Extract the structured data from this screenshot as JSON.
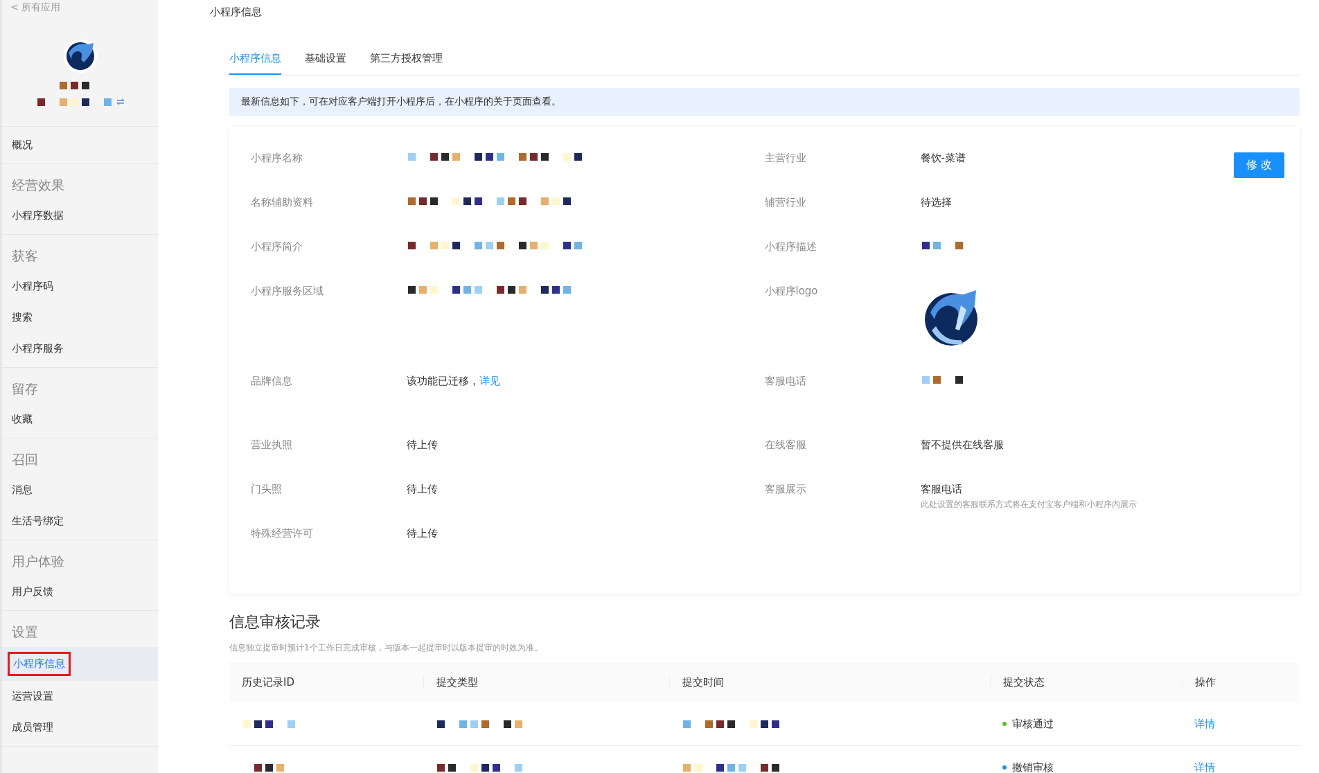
{
  "sidebar": {
    "back_link": "< 所有应用",
    "groups": [
      {
        "items": [
          {
            "label": "概况",
            "selected": false
          }
        ]
      },
      {
        "title": "经营效果",
        "items": [
          {
            "label": "小程序数据",
            "selected": false
          }
        ]
      },
      {
        "title": "获客",
        "items": [
          {
            "label": "小程序码",
            "selected": false
          },
          {
            "label": "搜索",
            "selected": false
          },
          {
            "label": "小程序服务",
            "selected": false
          }
        ]
      },
      {
        "title": "留存",
        "items": [
          {
            "label": "收藏",
            "selected": false
          }
        ]
      },
      {
        "title": "召回",
        "items": [
          {
            "label": "消息",
            "selected": false
          },
          {
            "label": "生活号绑定",
            "selected": false
          }
        ]
      },
      {
        "title": "用户体验",
        "items": [
          {
            "label": "用户反馈",
            "selected": false
          }
        ]
      },
      {
        "title": "设置",
        "items": [
          {
            "label": "小程序信息",
            "selected": true
          },
          {
            "label": "运营设置",
            "selected": false
          },
          {
            "label": "成员管理",
            "selected": false
          }
        ]
      }
    ]
  },
  "breadcrumb": "小程序信息",
  "tabs": [
    {
      "label": "小程序信息",
      "selected": true
    },
    {
      "label": "基础设置",
      "selected": false
    },
    {
      "label": "第三方授权管理",
      "selected": false
    }
  ],
  "notice": "最新信息如下，可在对应客户端打开小程序后，在小程序的关于页面查看。",
  "edit_button": "修 改",
  "info_rows": [
    {
      "left": {
        "label": "小程序名称",
        "kind": "redacted"
      },
      "right": {
        "label": "主营行业",
        "kind": "text",
        "value": "餐饮-菜谱"
      }
    },
    {
      "left": {
        "label": "名称辅助资料",
        "kind": "redacted"
      },
      "right": {
        "label": "辅营行业",
        "kind": "text",
        "value": "待选择"
      }
    },
    {
      "left": {
        "label": "小程序简介",
        "kind": "redacted"
      },
      "right": {
        "label": "小程序描述",
        "kind": "redacted"
      }
    },
    {
      "left": {
        "label": "小程序服务区域",
        "kind": "redacted"
      },
      "right": {
        "label": "小程序logo",
        "kind": "logo"
      }
    },
    {
      "left": {
        "label": "品牌信息",
        "kind": "link",
        "value": "该功能已迁移，",
        "link": "详见"
      },
      "right": {
        "label": "客服电话",
        "kind": "redacted"
      }
    },
    {
      "left": {
        "label": "营业执照",
        "kind": "text",
        "value": "待上传"
      },
      "right": {
        "label": "在线客服",
        "kind": "text",
        "value": "暂不提供在线客服"
      }
    },
    {
      "left": {
        "label": "门头照",
        "kind": "text",
        "value": "待上传"
      },
      "right": {
        "label": "客服展示",
        "kind": "text",
        "value": "客服电话",
        "note": "此处设置的客服联系方式将在支付宝客户端和小程序内展示"
      }
    },
    {
      "left": {
        "label": "特殊经营许可",
        "kind": "text",
        "value": "待上传"
      }
    }
  ],
  "audit": {
    "title": "信息审核记录",
    "description": "信息独立提审时预计1个工作日完成审核，与版本一起提审时以版本提审的时效为准。",
    "columns": [
      "历史记录ID",
      "提交类型",
      "提交时间",
      "提交状态",
      "操作"
    ],
    "rows": [
      {
        "status": "审核通过",
        "color": "#52c41a",
        "action": "详情"
      },
      {
        "status": "撤销审核",
        "color": "#1890ff",
        "action": "详情"
      }
    ]
  }
}
